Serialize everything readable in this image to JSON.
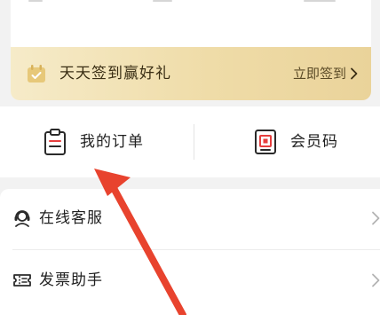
{
  "signin": {
    "label": "天天签到赢好礼",
    "action": "立即签到"
  },
  "quick_actions": [
    {
      "label": "我的订单",
      "icon": "clipboard-icon"
    },
    {
      "label": "会员码",
      "icon": "qr-code-icon"
    }
  ],
  "services": [
    {
      "label": "在线客服",
      "icon": "headset-icon"
    },
    {
      "label": "发票助手",
      "icon": "invoice-ticket-icon"
    }
  ],
  "colors": {
    "signin_gradient_start": "#f6ebc9",
    "signin_gradient_end": "#ead39a",
    "annotation_arrow": "#e8432e",
    "background": "#f2f2f2"
  }
}
